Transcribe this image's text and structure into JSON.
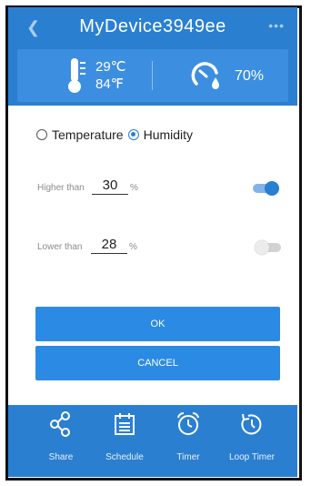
{
  "header": {
    "title": "MyDevice3949ee",
    "back_icon": "back-arrow-icon",
    "more_icon": "more-dots-icon"
  },
  "readings": {
    "temp_c": "29℃",
    "temp_f": "84℉",
    "humidity": "70%"
  },
  "mode": {
    "option_temperature": "Temperature",
    "option_humidity": "Humidity",
    "selected": "Humidity"
  },
  "thresholds": {
    "higher": {
      "label": "Higher than",
      "value": "30",
      "unit": "%",
      "enabled": true
    },
    "lower": {
      "label": "Lower than",
      "value": "28",
      "unit": "%",
      "enabled": false
    }
  },
  "buttons": {
    "ok": "OK",
    "cancel": "CANCEL"
  },
  "tabs": [
    {
      "label": "Share",
      "icon": "share-icon"
    },
    {
      "label": "Schedule",
      "icon": "calendar-icon"
    },
    {
      "label": "Timer",
      "icon": "alarm-clock-icon"
    },
    {
      "label": "Loop Timer",
      "icon": "loop-clock-icon"
    }
  ],
  "colors": {
    "primary": "#2b7fd0",
    "panel": "#3c8ee0",
    "button": "#2b8ae3"
  }
}
